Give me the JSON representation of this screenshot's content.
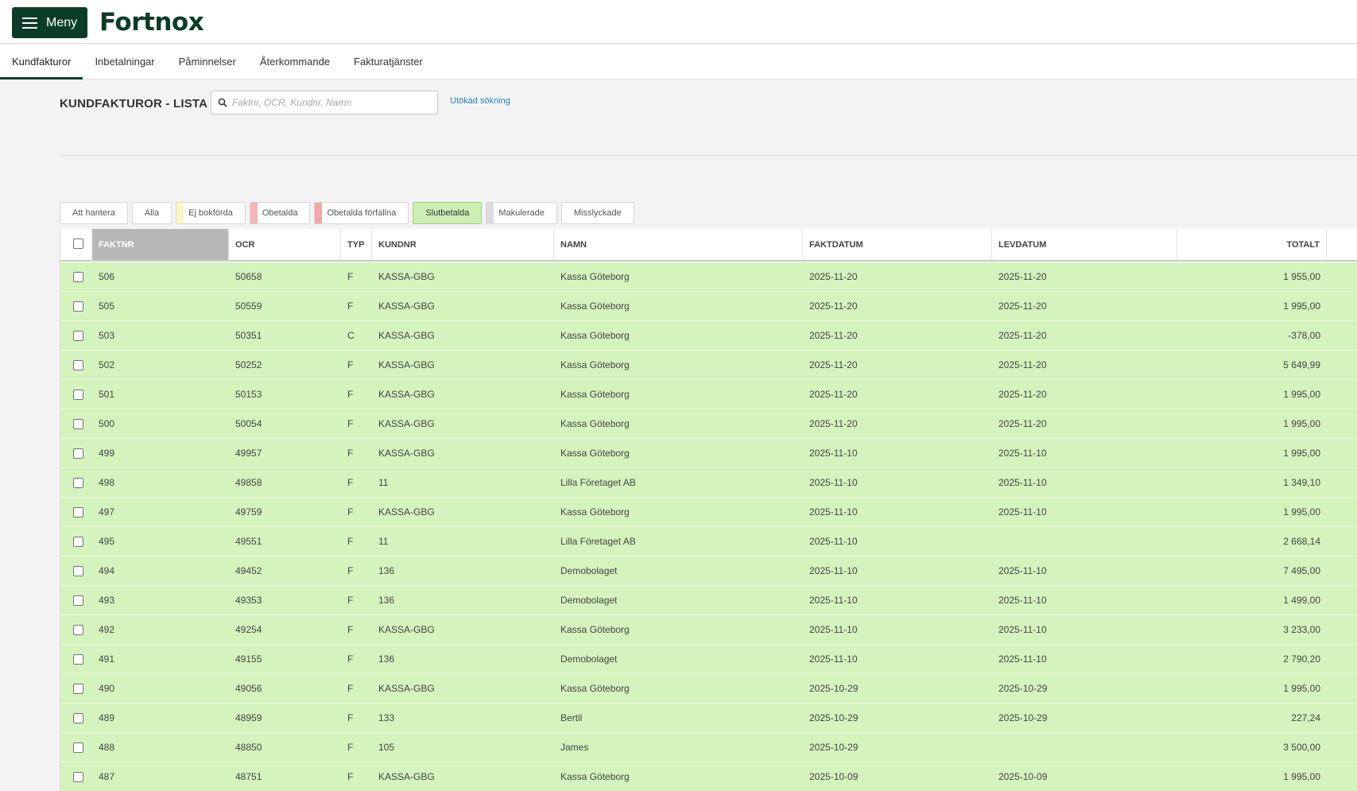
{
  "app": {
    "menu_label": "Meny",
    "logo_text": "Fortnox"
  },
  "tabs": [
    {
      "label": "Kundfakturor",
      "active": true
    },
    {
      "label": "Inbetalningar",
      "active": false
    },
    {
      "label": "Påminnelser",
      "active": false
    },
    {
      "label": "Återkommande",
      "active": false
    },
    {
      "label": "Fakturatjänster",
      "active": false
    }
  ],
  "header": {
    "title": "KUNDFAKTUROR - LISTA",
    "search_placeholder": "Faktnr, OCR, Kundnr, Namn",
    "search_value": "",
    "advanced_search": "Utökad sökning"
  },
  "filters": [
    {
      "label": "Att hantera",
      "marker": null,
      "active": false
    },
    {
      "label": "Alla",
      "marker": null,
      "active": false
    },
    {
      "label": "Ej bokförda",
      "marker": "#fbf5c2",
      "active": false
    },
    {
      "label": "Obetalda",
      "marker": "#f6b4b4",
      "active": false
    },
    {
      "label": "Obetalda förfallna",
      "marker": "#f3a7a7",
      "active": false
    },
    {
      "label": "Slutbetalda",
      "marker": null,
      "active": true
    },
    {
      "label": "Makulerade",
      "marker": "#dcdcdc",
      "active": false
    },
    {
      "label": "Misslyckade",
      "marker": null,
      "active": false
    }
  ],
  "table": {
    "columns": [
      {
        "key": "faktnr",
        "label": "FAKTNR",
        "sorted": true
      },
      {
        "key": "ocr",
        "label": "OCR"
      },
      {
        "key": "typ",
        "label": "TYP"
      },
      {
        "key": "kundnr",
        "label": "KUNDNR"
      },
      {
        "key": "namn",
        "label": "NAMN"
      },
      {
        "key": "faktdatum",
        "label": "FAKTDATUM"
      },
      {
        "key": "levdatum",
        "label": "LEVDATUM"
      },
      {
        "key": "totalt",
        "label": "TOTALT"
      }
    ],
    "rows": [
      {
        "faktnr": "506",
        "ocr": "50658",
        "typ": "F",
        "kundnr": "KASSA-GBG",
        "namn": "Kassa Göteborg",
        "faktdatum": "2025-11-20",
        "levdatum": "2025-11-20",
        "totalt": "1 955,00"
      },
      {
        "faktnr": "505",
        "ocr": "50559",
        "typ": "F",
        "kundnr": "KASSA-GBG",
        "namn": "Kassa Göteborg",
        "faktdatum": "2025-11-20",
        "levdatum": "2025-11-20",
        "totalt": "1 995,00"
      },
      {
        "faktnr": "503",
        "ocr": "50351",
        "typ": "C",
        "kundnr": "KASSA-GBG",
        "namn": "Kassa Göteborg",
        "faktdatum": "2025-11-20",
        "levdatum": "2025-11-20",
        "totalt": "-378,00"
      },
      {
        "faktnr": "502",
        "ocr": "50252",
        "typ": "F",
        "kundnr": "KASSA-GBG",
        "namn": "Kassa Göteborg",
        "faktdatum": "2025-11-20",
        "levdatum": "2025-11-20",
        "totalt": "5 649,99"
      },
      {
        "faktnr": "501",
        "ocr": "50153",
        "typ": "F",
        "kundnr": "KASSA-GBG",
        "namn": "Kassa Göteborg",
        "faktdatum": "2025-11-20",
        "levdatum": "2025-11-20",
        "totalt": "1 995,00"
      },
      {
        "faktnr": "500",
        "ocr": "50054",
        "typ": "F",
        "kundnr": "KASSA-GBG",
        "namn": "Kassa Göteborg",
        "faktdatum": "2025-11-20",
        "levdatum": "2025-11-20",
        "totalt": "1 995,00"
      },
      {
        "faktnr": "499",
        "ocr": "49957",
        "typ": "F",
        "kundnr": "KASSA-GBG",
        "namn": "Kassa Göteborg",
        "faktdatum": "2025-11-10",
        "levdatum": "2025-11-10",
        "totalt": "1 995,00"
      },
      {
        "faktnr": "498",
        "ocr": "49858",
        "typ": "F",
        "kundnr": "11",
        "namn": "Lilla Företaget AB",
        "faktdatum": "2025-11-10",
        "levdatum": "2025-11-10",
        "totalt": "1 349,10"
      },
      {
        "faktnr": "497",
        "ocr": "49759",
        "typ": "F",
        "kundnr": "KASSA-GBG",
        "namn": "Kassa Göteborg",
        "faktdatum": "2025-11-10",
        "levdatum": "2025-11-10",
        "totalt": "1 995,00"
      },
      {
        "faktnr": "495",
        "ocr": "49551",
        "typ": "F",
        "kundnr": "11",
        "namn": "Lilla Företaget AB",
        "faktdatum": "2025-11-10",
        "levdatum": "",
        "totalt": "2 668,14"
      },
      {
        "faktnr": "494",
        "ocr": "49452",
        "typ": "F",
        "kundnr": "136",
        "namn": "Demobolaget",
        "faktdatum": "2025-11-10",
        "levdatum": "2025-11-10",
        "totalt": "7 495,00"
      },
      {
        "faktnr": "493",
        "ocr": "49353",
        "typ": "F",
        "kundnr": "136",
        "namn": "Demobolaget",
        "faktdatum": "2025-11-10",
        "levdatum": "2025-11-10",
        "totalt": "1 499,00"
      },
      {
        "faktnr": "492",
        "ocr": "49254",
        "typ": "F",
        "kundnr": "KASSA-GBG",
        "namn": "Kassa Göteborg",
        "faktdatum": "2025-11-10",
        "levdatum": "2025-11-10",
        "totalt": "3 233,00"
      },
      {
        "faktnr": "491",
        "ocr": "49155",
        "typ": "F",
        "kundnr": "136",
        "namn": "Demobolaget",
        "faktdatum": "2025-11-10",
        "levdatum": "2025-11-10",
        "totalt": "2 790,20"
      },
      {
        "faktnr": "490",
        "ocr": "49056",
        "typ": "F",
        "kundnr": "KASSA-GBG",
        "namn": "Kassa Göteborg",
        "faktdatum": "2025-10-29",
        "levdatum": "2025-10-29",
        "totalt": "1 995,00"
      },
      {
        "faktnr": "489",
        "ocr": "48959",
        "typ": "F",
        "kundnr": "133",
        "namn": "Bertil",
        "faktdatum": "2025-10-29",
        "levdatum": "2025-10-29",
        "totalt": "227,24"
      },
      {
        "faktnr": "488",
        "ocr": "48850",
        "typ": "F",
        "kundnr": "105",
        "namn": "James",
        "faktdatum": "2025-10-29",
        "levdatum": "",
        "totalt": "3 500,00"
      },
      {
        "faktnr": "487",
        "ocr": "48751",
        "typ": "F",
        "kundnr": "KASSA-GBG",
        "namn": "Kassa Göteborg",
        "faktdatum": "2025-10-09",
        "levdatum": "2025-10-09",
        "totalt": "1 995,00"
      }
    ]
  },
  "colors": {
    "brand": "#0b3d26",
    "row_paid": "#d5f3bd",
    "link": "#1d84b5"
  }
}
